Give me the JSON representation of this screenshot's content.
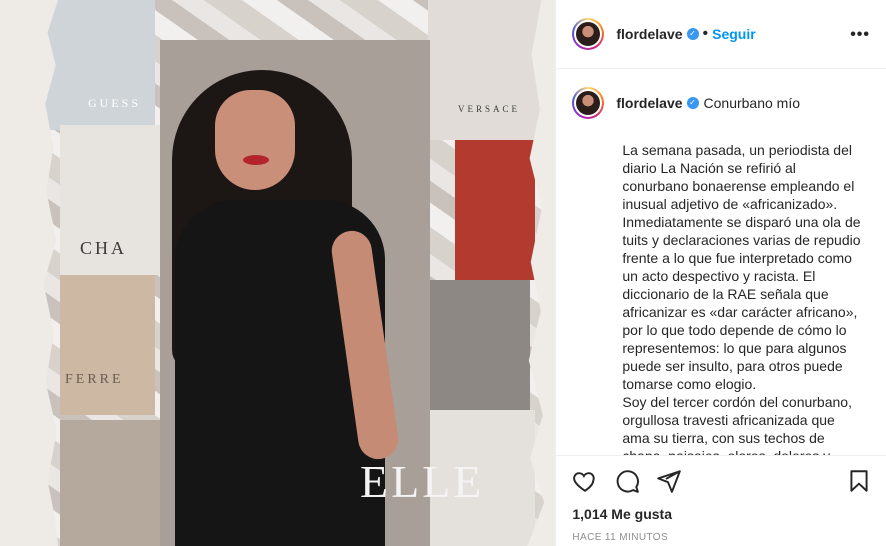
{
  "post": {
    "username": "flordelave",
    "follow_label": "Seguir",
    "dot": "•",
    "more_label": "•••",
    "caption_title": "Conurbano mío",
    "caption_body": "La semana pasada, un periodista del\ndiario La Nación se refirió al\nconurbano bonaerense empleando el\ninusual adjetivo de «africanizado».\nInmediatamente se disparó una ola de\ntuits y declaraciones varias de repudio\nfrente a lo que fue interpretado como\nun acto despectivo y racista. El\ndiccionario de la RAE señala que\nafricanizar es «dar carácter africano»,\npor lo que todo depende de cómo lo\nrepresentemos: lo que para algunos\npuede ser insulto, para otros puede\ntomarse como elogio.\nSoy del tercer cordón del conurbano,\norgullosa travesti africanizada que\nama su tierra, con sus techos de\nchapa, paisajes, olores, dolores y",
    "likes": "1,014 Me gusta",
    "timestamp": "HACE 11 MINUTOS",
    "verified_glyph": "✓"
  },
  "image": {
    "magazine_words": [
      "CHA",
      "ELLE",
      "GUESS",
      "FERRE",
      "VERSACE"
    ]
  },
  "icons": {
    "like": "heart-icon",
    "comment": "comment-icon",
    "share": "share-icon",
    "save": "bookmark-icon",
    "more": "more-options-icon",
    "verified": "verified-badge-icon"
  },
  "colors": {
    "accent": "#0095f6",
    "verified": "#3897f0",
    "text": "#262626",
    "muted": "#8e8e8e"
  }
}
